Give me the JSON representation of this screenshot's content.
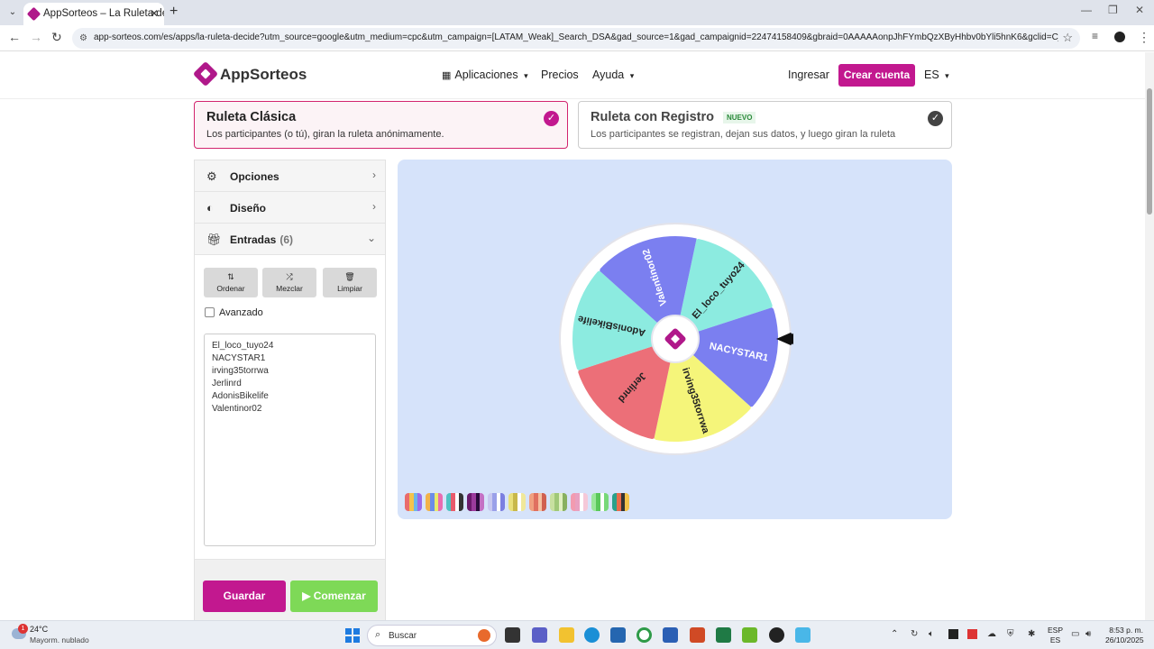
{
  "browser": {
    "tab_title": "AppSorteos – La Ruleta de la S",
    "url": "app-sorteos.com/es/apps/la-ruleta-decide?utm_source=google&utm_medium=cpc&utm_campaign=[LATAM_Weak]_Search_DSA&gad_source=1&gad_campaignid=22474158409&gbraid=0AAAAAonpJhFYmbQzXByHhbv0bYli5hnK6&gclid=CjwKCAjwjffHBhB..."
  },
  "header": {
    "logo_text": "AppSorteos",
    "nav": {
      "apps": "Aplicaciones",
      "pricing": "Precios",
      "help": "Ayuda"
    },
    "login": "Ingresar",
    "signup": "Crear cuenta",
    "lang": "ES"
  },
  "modes": {
    "classic": {
      "title": "Ruleta Clásica",
      "desc": "Los participantes (o tú), giran la ruleta anónimamente."
    },
    "registered": {
      "title": "Ruleta con Registro",
      "badge": "NUEVO",
      "desc": "Los participantes se registran, dejan sus datos, y luego giran la ruleta"
    }
  },
  "panel": {
    "options": "Opciones",
    "design": "Diseño",
    "entries": "Entradas",
    "entries_count": "(6)",
    "sort": "Ordenar",
    "shuffle": "Mezclar",
    "clear": "Limpiar",
    "advanced": "Avanzado",
    "entry_list": [
      "El_loco_tuyo24",
      "NACYSTAR1",
      "irving35torrwa",
      "Jerlinrd",
      "AdonisBikelife",
      "Valentinor02"
    ],
    "save": "Guardar",
    "start": "Comenzar"
  },
  "wheel": {
    "segments": [
      {
        "label": "El_loco_tuyo24",
        "color": "#8cebe0"
      },
      {
        "label": "NACYSTAR1",
        "color": "#7b7ff0"
      },
      {
        "label": "irving35torrwa",
        "color": "#f5f57a"
      },
      {
        "label": "Jerlinrd",
        "color": "#ec6f78"
      },
      {
        "label": "AdonisBikelife",
        "color": "#8cebe0"
      },
      {
        "label": "Valentinor02",
        "color": "#7b7ff0"
      }
    ]
  },
  "taskbar": {
    "weather_temp": "24°C",
    "weather_desc": "Mayorm. nublado",
    "notif_count": "1",
    "search": "Buscar",
    "lang_line1": "ESP",
    "lang_line2": "ES",
    "time": "8:53 p. m.",
    "date": "26/10/2025"
  }
}
